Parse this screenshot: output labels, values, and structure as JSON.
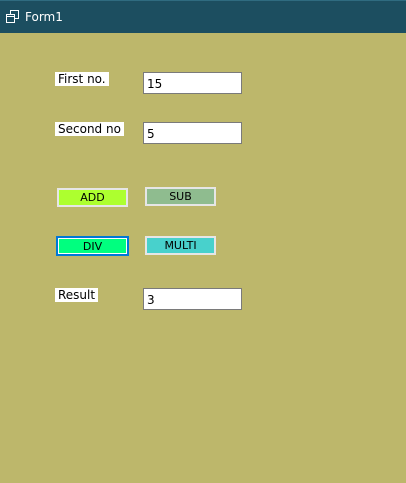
{
  "window": {
    "title": "Form1",
    "icon": "form-window-icon"
  },
  "labels": {
    "first": "First no.",
    "second": "Second no",
    "result": "Result"
  },
  "fields": {
    "first_value": "15",
    "second_value": "5",
    "result_value": "3"
  },
  "buttons": {
    "add": "ADD",
    "sub": "SUB",
    "div": "DIV",
    "multi": "MULTI"
  },
  "colors": {
    "form_background": "#bdb76b",
    "titlebar": "#1c4e60",
    "add_button": "#adff2f",
    "sub_button": "#8fbc8f",
    "div_button": "#00ff7f",
    "multi_button": "#48d1cc",
    "focus_border": "#0078d7"
  }
}
